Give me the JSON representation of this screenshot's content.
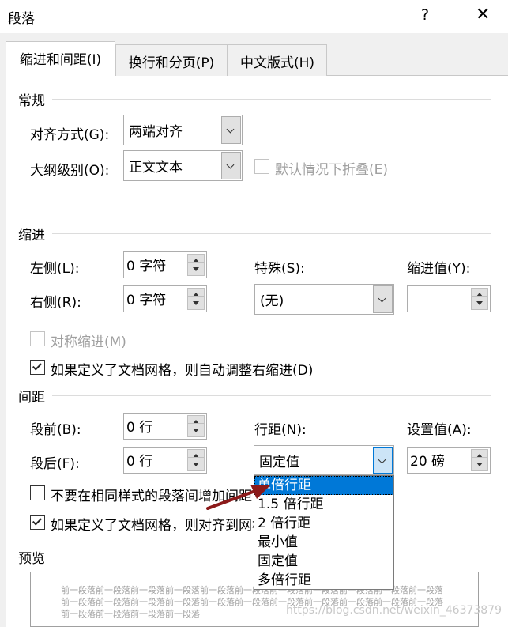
{
  "window": {
    "title": "段落",
    "help": "?",
    "close": "✕"
  },
  "tabs": [
    "缩进和间距(I)",
    "换行和分页(P)",
    "中文版式(H)"
  ],
  "general": {
    "heading": "常规",
    "alignment_label": "对齐方式(G):",
    "alignment_value": "两端对齐",
    "outline_label": "大纲级别(O):",
    "outline_value": "正文文本",
    "collapse_label": "默认情况下折叠(E)"
  },
  "indent": {
    "heading": "缩进",
    "left_label": "左侧(L):",
    "left_value": "0 字符",
    "right_label": "右侧(R):",
    "right_value": "0 字符",
    "special_label": "特殊(S):",
    "special_value": "(无)",
    "by_label": "缩进值(Y):",
    "by_value": "",
    "mirror_label": "对称缩进(M)",
    "auto_adjust_label": "如果定义了文档网格，则自动调整右缩进(D)"
  },
  "spacing": {
    "heading": "间距",
    "before_label": "段前(B):",
    "before_value": "0 行",
    "after_label": "段后(F):",
    "after_value": "0 行",
    "line_label": "行距(N):",
    "line_value": "固定值",
    "at_label": "设置值(A):",
    "at_value": "20 磅",
    "no_space_label": "不要在相同样式的段落间增加间距",
    "snap_grid_label": "如果定义了文档网格，则对齐到网格"
  },
  "line_spacing_options": [
    "单倍行距",
    "1.5 倍行距",
    "2 倍行距",
    "最小值",
    "固定值",
    "多倍行距"
  ],
  "preview": {
    "heading": "预览",
    "lines": [
      "前一段落前一段落前一段落前一段落前一段落前一段落前一段落前一段落前一段落前一段落前一段落",
      "前一段落前一段落前一段落前一段落前一段落前一段落前一段落前一段落前一段落前一段落前一段落",
      "前一段落前一段落前一段落前一段落"
    ]
  },
  "watermark": "https://blog.csdn.net/weixin_46373879",
  "colors": {
    "accent": "#0078d7",
    "arrow": "#8b1a1a"
  }
}
